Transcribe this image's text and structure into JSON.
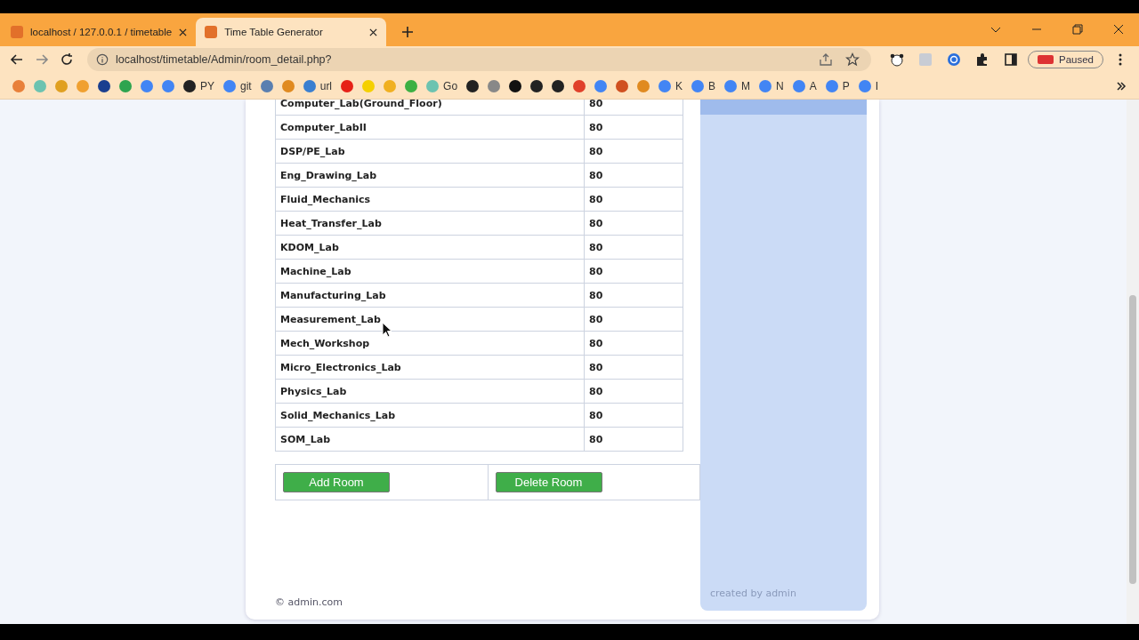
{
  "tabs": [
    {
      "title": "localhost / 127.0.0.1 / timetable",
      "selected": false
    },
    {
      "title": "Time Table Generator",
      "selected": true
    }
  ],
  "address": "localhost/timetable/Admin/room_detail.php?",
  "profile": "Paused",
  "bookmarks": [
    {
      "color": "#e8803a"
    },
    {
      "color": "#6cc3b0"
    },
    {
      "color": "#e0a020"
    },
    {
      "color": "#f0a030"
    },
    {
      "color": "#1a3f8f"
    },
    {
      "color": "#2ea44f"
    },
    {
      "color": "#4285f4"
    },
    {
      "color": "#4285f4"
    },
    {
      "label": "PY",
      "color": "#222222"
    },
    {
      "label": "git",
      "color": "#4285f4"
    },
    {
      "color": "#5a7fb0"
    },
    {
      "color": "#e08a20"
    },
    {
      "label": "url",
      "color": "#3a7fd0"
    },
    {
      "color": "#e62117"
    },
    {
      "color": "#f5d000"
    },
    {
      "color": "#f0b020"
    },
    {
      "color": "#3cb043"
    },
    {
      "label": "Go",
      "color": "#6cc3b0"
    },
    {
      "color": "#222222"
    },
    {
      "color": "#888888"
    },
    {
      "color": "#111111"
    },
    {
      "color": "#222222"
    },
    {
      "color": "#222222"
    },
    {
      "color": "#e0402a"
    },
    {
      "color": "#4285f4"
    },
    {
      "color": "#d05020"
    },
    {
      "color": "#e08a20"
    },
    {
      "label": "K",
      "color": "#4285f4"
    },
    {
      "label": "B",
      "color": "#4285f4"
    },
    {
      "label": "M",
      "color": "#4285f4"
    },
    {
      "label": "N",
      "color": "#4285f4"
    },
    {
      "label": "A",
      "color": "#4285f4"
    },
    {
      "label": "P",
      "color": "#4285f4"
    },
    {
      "label": "I",
      "color": "#4285f4"
    }
  ],
  "rooms": [
    {
      "name": "Computer_Lab(Ground_Floor)",
      "capacity": "80"
    },
    {
      "name": "Computer_LabII",
      "capacity": "80"
    },
    {
      "name": "DSP/PE_Lab",
      "capacity": "80"
    },
    {
      "name": "Eng_Drawing_Lab",
      "capacity": "80"
    },
    {
      "name": "Fluid_Mechanics",
      "capacity": "80"
    },
    {
      "name": "Heat_Transfer_Lab",
      "capacity": "80"
    },
    {
      "name": "KDOM_Lab",
      "capacity": "80"
    },
    {
      "name": "Machine_Lab",
      "capacity": "80"
    },
    {
      "name": "Manufacturing_Lab",
      "capacity": "80"
    },
    {
      "name": "Measurement_Lab",
      "capacity": "80"
    },
    {
      "name": "Mech_Workshop",
      "capacity": "80"
    },
    {
      "name": "Micro_Electronics_Lab",
      "capacity": "80"
    },
    {
      "name": "Physics_Lab",
      "capacity": "80"
    },
    {
      "name": "Solid_Mechanics_Lab",
      "capacity": "80"
    },
    {
      "name": "SOM_Lab",
      "capacity": "80"
    }
  ],
  "buttons": [
    "Add Room",
    "Delete Room"
  ],
  "footer": {
    "left": "© admin.com",
    "right": "created by admin"
  }
}
